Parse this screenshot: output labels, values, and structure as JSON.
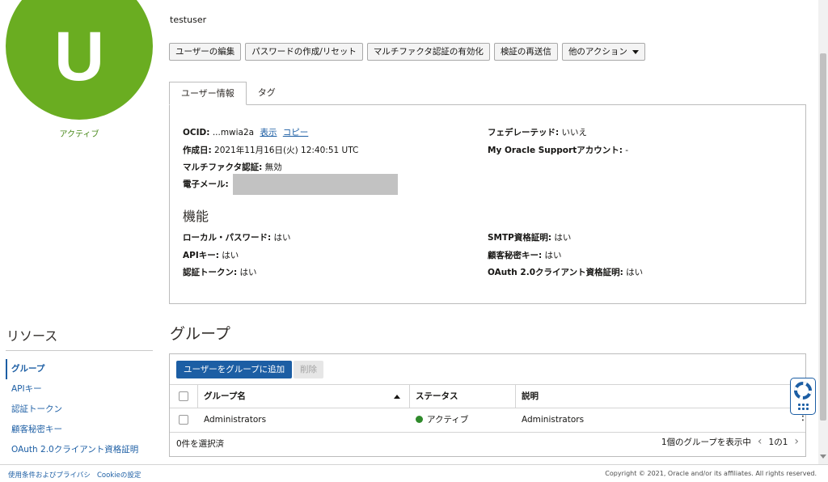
{
  "avatar": {
    "letter": "U",
    "status": "アクティブ",
    "color": "#6aad21"
  },
  "user": {
    "name": "testuser"
  },
  "actions": {
    "edit": "ユーザーの編集",
    "password": "パスワードの作成/リセット",
    "mfa": "マルチファクタ認証の有効化",
    "resend": "検証の再送信",
    "more": "他のアクション"
  },
  "tabs": {
    "info": "ユーザー情報",
    "tags": "タグ"
  },
  "info": {
    "ocid_label": "OCID:",
    "ocid_value": "...mwia2a",
    "show_link": "表示",
    "copy_link": "コピー",
    "created_label": "作成日:",
    "created_value": "2021年11月16日(火) 12:40:51 UTC",
    "mfa_label": "マルチファクタ認証:",
    "mfa_value": "無効",
    "email_label": "電子メール:",
    "federated_label": "フェデレーテッド:",
    "federated_value": "いいえ",
    "mos_label": "My Oracle Supportアカウント:",
    "mos_value": "-"
  },
  "capabilities": {
    "title": "機能",
    "local_pw_label": "ローカル・パスワード:",
    "local_pw_value": "はい",
    "api_label": "APIキー:",
    "api_value": "はい",
    "auth_token_label": "認証トークン:",
    "auth_token_value": "はい",
    "smtp_label": "SMTP資格証明:",
    "smtp_value": "はい",
    "secret_label": "顧客秘密キー:",
    "secret_value": "はい",
    "oauth_label": "OAuth 2.0クライアント資格証明:",
    "oauth_value": "はい"
  },
  "resources": {
    "title": "リソース",
    "items": [
      {
        "label": "グループ",
        "active": true
      },
      {
        "label": "APIキー"
      },
      {
        "label": "認証トークン"
      },
      {
        "label": "顧客秘密キー"
      },
      {
        "label": "OAuth 2.0クライアント資格証明"
      }
    ]
  },
  "groups": {
    "title": "グループ",
    "add_label": "ユーザーをグループに追加",
    "delete_label": "削除",
    "columns": {
      "name": "グループ名",
      "status": "ステータス",
      "desc": "説明"
    },
    "rows": [
      {
        "name": "Administrators",
        "status": "アクティブ",
        "desc": "Administrators"
      }
    ],
    "selected_text": "0件を選択済",
    "showing_text": "1個のグループを表示中",
    "page_text": "1の1"
  },
  "footer": {
    "terms": "使用条件およびプライバシ",
    "cookie": "Cookieの設定",
    "copyright": "Copyright © 2021, Oracle and/or its affiliates. All rights reserved."
  }
}
